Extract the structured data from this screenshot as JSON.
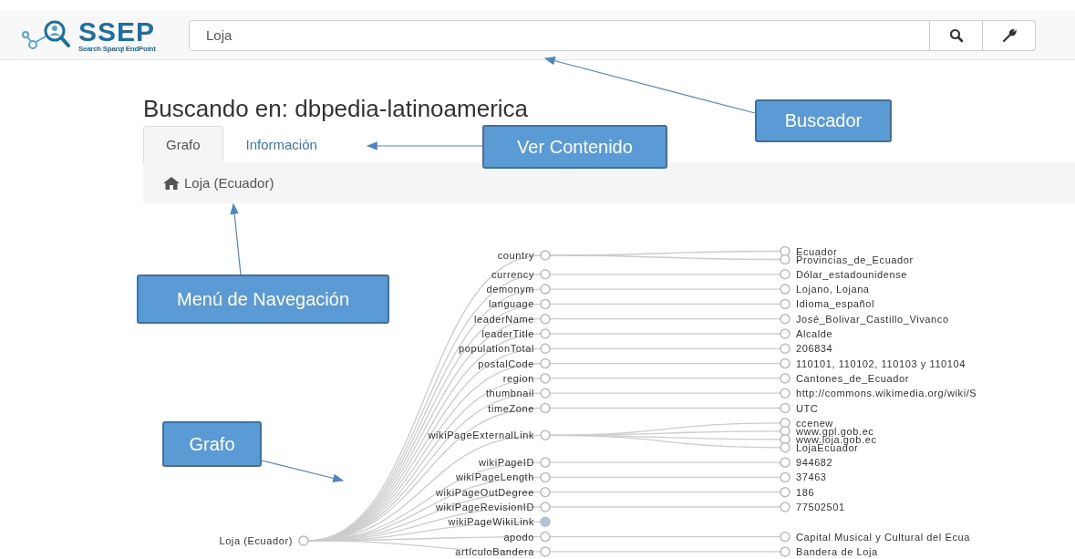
{
  "header": {
    "logo": {
      "title": "SSEP",
      "subtitle": "Search Sparql EndPoint"
    },
    "search": {
      "value": "Loja"
    }
  },
  "heading": "Buscando en: dbpedia-latinoamerica",
  "tabs": [
    {
      "label": "Grafo",
      "selected": true
    },
    {
      "label": "Información",
      "selected": false
    }
  ],
  "breadcrumb": {
    "label": "Loja (Ecuador)"
  },
  "graph": {
    "root": "Loja (Ecuador)",
    "predicates": [
      {
        "label": "country",
        "collapsed": false,
        "children": [
          "Ecuador",
          "Provincias_de_Ecuador"
        ]
      },
      {
        "label": "currency",
        "collapsed": false,
        "children": [
          "Dólar_estadounidense"
        ]
      },
      {
        "label": "demonym",
        "collapsed": false,
        "children": [
          "Lojano, Lojana"
        ]
      },
      {
        "label": "language",
        "collapsed": false,
        "children": [
          "Idioma_español"
        ]
      },
      {
        "label": "leaderName",
        "collapsed": false,
        "children": [
          "José_Bolivar_Castillo_Vivanco"
        ]
      },
      {
        "label": "leaderTitle",
        "collapsed": false,
        "children": [
          "Alcalde"
        ]
      },
      {
        "label": "populationTotal",
        "collapsed": false,
        "children": [
          "206834"
        ]
      },
      {
        "label": "postalCode",
        "collapsed": false,
        "children": [
          "110101, 110102, 110103 y 110104"
        ]
      },
      {
        "label": "region",
        "collapsed": false,
        "children": [
          "Cantones_de_Ecuador"
        ]
      },
      {
        "label": "thumbnail",
        "collapsed": false,
        "children": [
          "http://commons.wikimedia.org/wiki/S"
        ]
      },
      {
        "label": "timeZone",
        "collapsed": false,
        "children": [
          "UTC"
        ]
      },
      {
        "label": "wikiPageExternalLink",
        "collapsed": false,
        "children": [
          "ccenew",
          "www.gpl.gob.ec",
          "www.loja.gob.ec",
          "LojaEcuador"
        ]
      },
      {
        "label": "wikiPageID",
        "collapsed": false,
        "children": [
          "944682"
        ]
      },
      {
        "label": "wikiPageLength",
        "collapsed": false,
        "children": [
          "37463"
        ]
      },
      {
        "label": "wikiPageOutDegree",
        "collapsed": false,
        "children": [
          "186"
        ]
      },
      {
        "label": "wikiPageRevisionID",
        "collapsed": false,
        "children": [
          "77502501"
        ]
      },
      {
        "label": "wikiPageWikiLink",
        "collapsed": true
      },
      {
        "label": "apodo",
        "collapsed": false,
        "children": [
          "Capital Musical y Cultural del Ecua"
        ]
      },
      {
        "label": "artículoBandera",
        "collapsed": false,
        "children": [
          "Bandera de Loja"
        ]
      }
    ]
  },
  "callouts": [
    {
      "text": "Buscador"
    },
    {
      "text": "Ver Contenido"
    },
    {
      "text": "Menú de Navegación"
    },
    {
      "text": "Grafo"
    }
  ]
}
